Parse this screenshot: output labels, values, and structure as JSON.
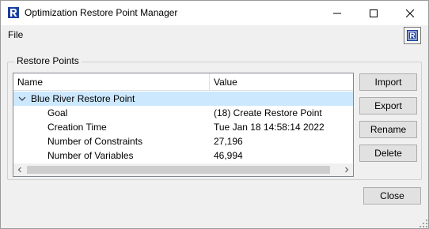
{
  "window": {
    "title": "Optimization Restore Point Manager",
    "app_icon": "riverware-logo-icon",
    "controls": [
      "minimize-icon",
      "maximize-icon",
      "close-icon"
    ]
  },
  "menu": {
    "file_label": "File",
    "right_icon": "riverware-logo-icon"
  },
  "group": {
    "label": "Restore Points"
  },
  "table": {
    "columns": [
      "Name",
      "Value"
    ],
    "rows": [
      {
        "name": "Blue River Restore Point",
        "value": "",
        "level": 0,
        "expanded": true,
        "selected": true
      },
      {
        "name": "Goal",
        "value": "(18) Create Restore Point",
        "level": 1
      },
      {
        "name": "Creation Time",
        "value": "Tue Jan 18 14:58:14 2022",
        "level": 1
      },
      {
        "name": "Number of Constraints",
        "value": "27,196",
        "level": 1
      },
      {
        "name": "Number of Variables",
        "value": "46,994",
        "level": 1
      }
    ]
  },
  "buttons": {
    "import": "Import",
    "export": "Export",
    "rename": "Rename",
    "delete": "Delete",
    "close": "Close"
  },
  "colors": {
    "selection": "#cce8ff",
    "accent_blue": "#1a3fa0",
    "background": "#f0f0f0"
  }
}
